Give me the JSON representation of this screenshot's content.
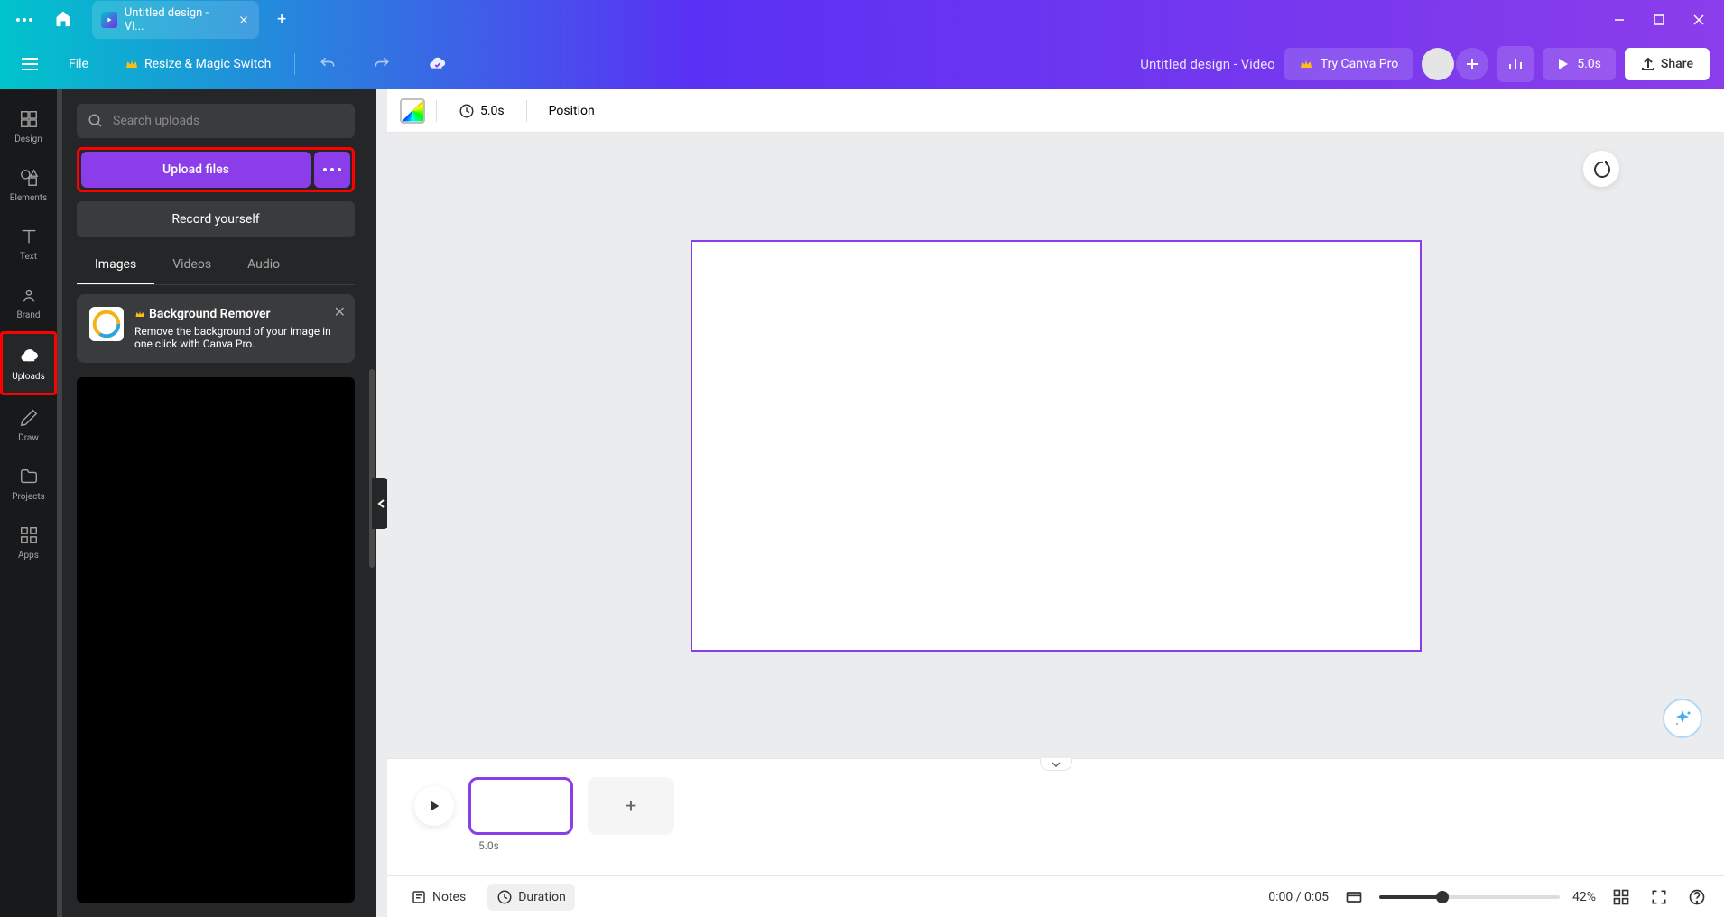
{
  "titlebar": {
    "tab_title": "Untitled design - Vi..."
  },
  "toolbar": {
    "file": "File",
    "resize": "Resize & Magic Switch",
    "doc_title": "Untitled design - Video",
    "try_pro": "Try Canva Pro",
    "play_duration": "5.0s",
    "share": "Share"
  },
  "nav": {
    "design": "Design",
    "elements": "Elements",
    "text": "Text",
    "brand": "Brand",
    "uploads": "Uploads",
    "draw": "Draw",
    "projects": "Projects",
    "apps": "Apps"
  },
  "panel": {
    "search_placeholder": "Search uploads",
    "upload_files": "Upload files",
    "record_yourself": "Record yourself",
    "tabs": {
      "images": "Images",
      "videos": "Videos",
      "audio": "Audio"
    },
    "promo": {
      "title": "Background Remover",
      "desc": "Remove the background of your image in one click with Canva Pro."
    }
  },
  "canvas_toolbar": {
    "duration": "5.0s",
    "position": "Position"
  },
  "timeline": {
    "scene_duration": "5.0s"
  },
  "bottom": {
    "notes": "Notes",
    "duration": "Duration",
    "time": "0:00 / 0:05",
    "zoom": "42%"
  }
}
